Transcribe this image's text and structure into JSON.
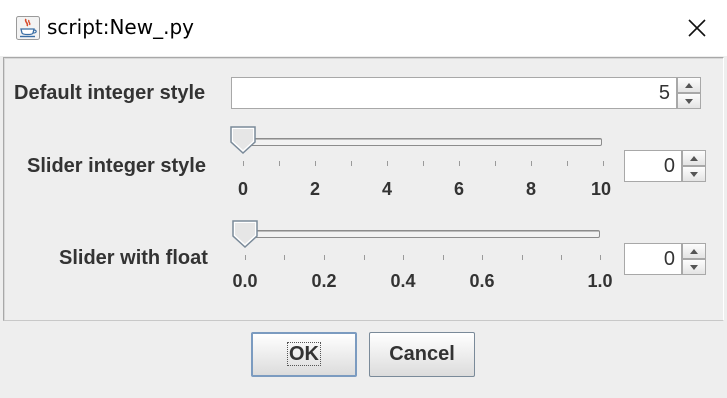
{
  "window": {
    "title": "script:New_.py",
    "icon": "java-cup-icon",
    "close_icon": "close-icon"
  },
  "fields": {
    "default_integer": {
      "label": "Default integer style",
      "value": "5"
    },
    "slider_integer": {
      "label": "Slider integer style",
      "value": "0",
      "slider_value": 0,
      "range": [
        0,
        10
      ],
      "tick_labels": [
        "0",
        "2",
        "4",
        "6",
        "8",
        "10"
      ]
    },
    "slider_float": {
      "label": "Slider with float",
      "value": "0",
      "slider_value": 0.0,
      "range": [
        0.0,
        1.0
      ],
      "tick_labels": [
        "0.0",
        "0.2",
        "0.4",
        "0.6",
        "1.0"
      ]
    }
  },
  "buttons": {
    "ok": "OK",
    "cancel": "Cancel"
  },
  "colors": {
    "background": "#eeeeee",
    "button_border": "#7a8a99",
    "focus_border": "#7b9bc0"
  }
}
